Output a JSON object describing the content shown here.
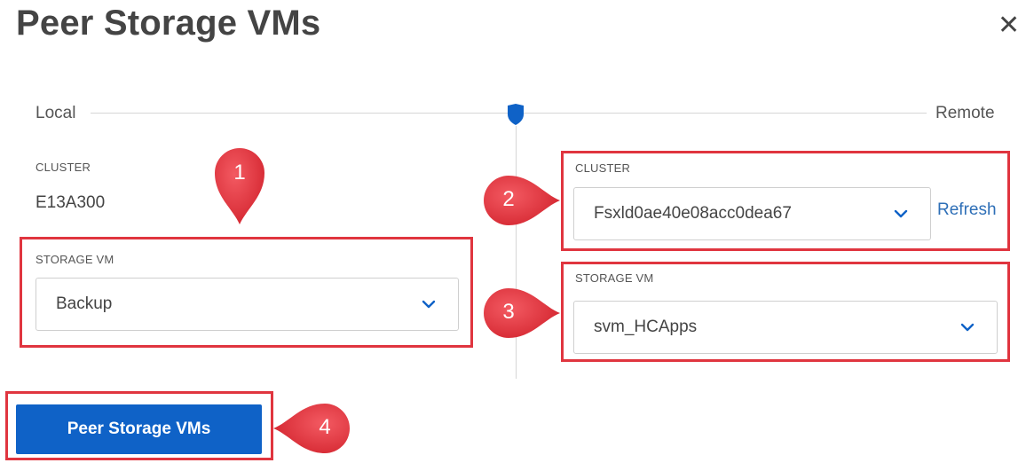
{
  "dialog": {
    "title": "Peer Storage VMs",
    "close_icon": "close-icon"
  },
  "slider": {
    "left_label": "Local",
    "right_label": "Remote"
  },
  "local": {
    "cluster_label": "CLUSTER",
    "cluster_value": "E13A300",
    "storage_vm_label": "STORAGE VM",
    "storage_vm_value": "Backup"
  },
  "remote": {
    "cluster_label": "CLUSTER",
    "cluster_value": "Fsxld0ae40e08acc0dea67",
    "refresh_label": "Refresh",
    "storage_vm_label": "STORAGE VM",
    "storage_vm_value": "svm_HCApps"
  },
  "actions": {
    "peer_button": "Peer Storage VMs"
  },
  "callouts": [
    "1",
    "2",
    "3",
    "4"
  ],
  "colors": {
    "accent": "#0f62c7",
    "callout": "#e0353f",
    "link": "#2e6fb7"
  }
}
